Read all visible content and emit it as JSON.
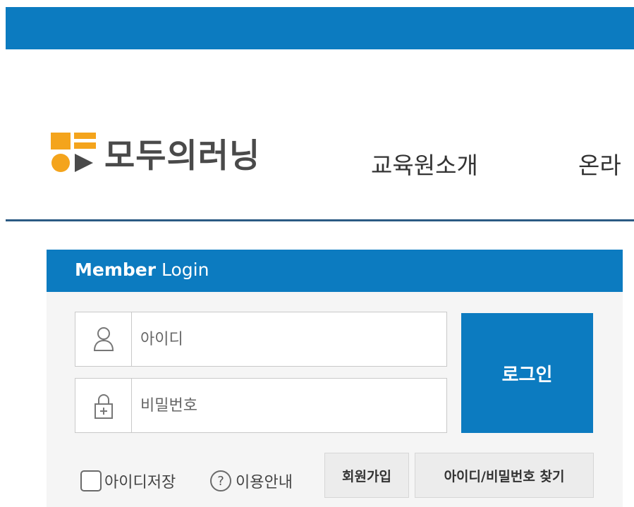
{
  "header": {
    "logo_text": "모두의러닝",
    "nav_items": [
      "교육원소개",
      "온라"
    ]
  },
  "login": {
    "title_bold": "Member",
    "title_light": " Login",
    "id_placeholder": "아이디",
    "password_placeholder": "비밀번호",
    "login_button": "로그인",
    "remember_label": "아이디저장",
    "help_label": "이용안내",
    "signup_button": "회원가입",
    "find_button": "아이디/비밀번호 찾기"
  },
  "icons": {
    "user": "user-icon",
    "lock": "lock-icon",
    "help": "question-icon",
    "logo": "logo-mark"
  },
  "colors": {
    "accent": "#0c7bc0",
    "logo_orange": "#f4a41c",
    "logo_dark": "#4a4a4a"
  }
}
